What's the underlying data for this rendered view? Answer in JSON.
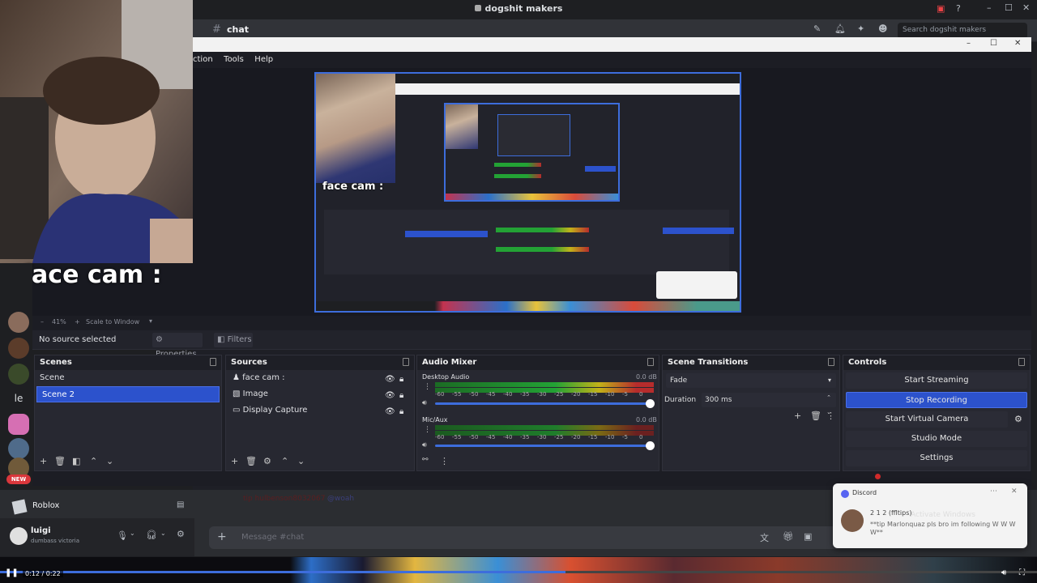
{
  "discord": {
    "server_title": "dogshit makers",
    "channel": "chat",
    "search_placeholder": "Search dogshit makers",
    "message_placeholder": "Message #chat",
    "new_badge": "NEW",
    "roblox_label": "Roblox",
    "user_name": "luigi",
    "user_status": "dumbass victoria",
    "server_initial": "le",
    "faded_message_author": "tip hulbenson8032067",
    "faded_message_text": "@woah"
  },
  "webcam": {
    "label": "face cam :"
  },
  "obs": {
    "menu": [
      "ction",
      "Tools",
      "Help"
    ],
    "zoom": "41%",
    "scale_mode": "Scale to Window",
    "no_source": "No source selected",
    "properties_label": "Properties",
    "filters_label": "Filters",
    "scenes": {
      "title": "Scenes",
      "items": [
        "Scene",
        "Scene 2"
      ],
      "selected": "Scene 2"
    },
    "sources": {
      "title": "Sources",
      "items": [
        "face cam :",
        "Image",
        "Display Capture"
      ]
    },
    "audio": {
      "title": "Audio Mixer",
      "channels": [
        {
          "name": "Desktop Audio",
          "db": "0.0 dB"
        },
        {
          "name": "Mic/Aux",
          "db": "0.0 dB"
        }
      ],
      "ticks": [
        "-60",
        "-55",
        "-50",
        "-45",
        "-40",
        "-35",
        "-30",
        "-25",
        "-20",
        "-15",
        "-10",
        "-5",
        "0"
      ]
    },
    "transitions": {
      "title": "Scene Transitions",
      "type": "Fade",
      "duration_label": "Duration",
      "duration": "300 ms"
    },
    "controls": {
      "title": "Controls",
      "buttons": [
        "Start Streaming",
        "Stop Recording",
        "Start Virtual Camera",
        "Studio Mode",
        "Settings"
      ]
    },
    "preview_label": "face cam :"
  },
  "notification": {
    "app": "Discord",
    "sender": "2 1 2 (ffltips)",
    "message": "**tip Marlonquaz pls bro im following W W W W**",
    "watermark": "Activate Windows"
  },
  "player": {
    "time": "0:12 / 0:22",
    "progress": 0.545
  },
  "colors": {
    "accent": "#2c52cc",
    "discord_bg": "#313338",
    "obs_bg": "#272831"
  }
}
